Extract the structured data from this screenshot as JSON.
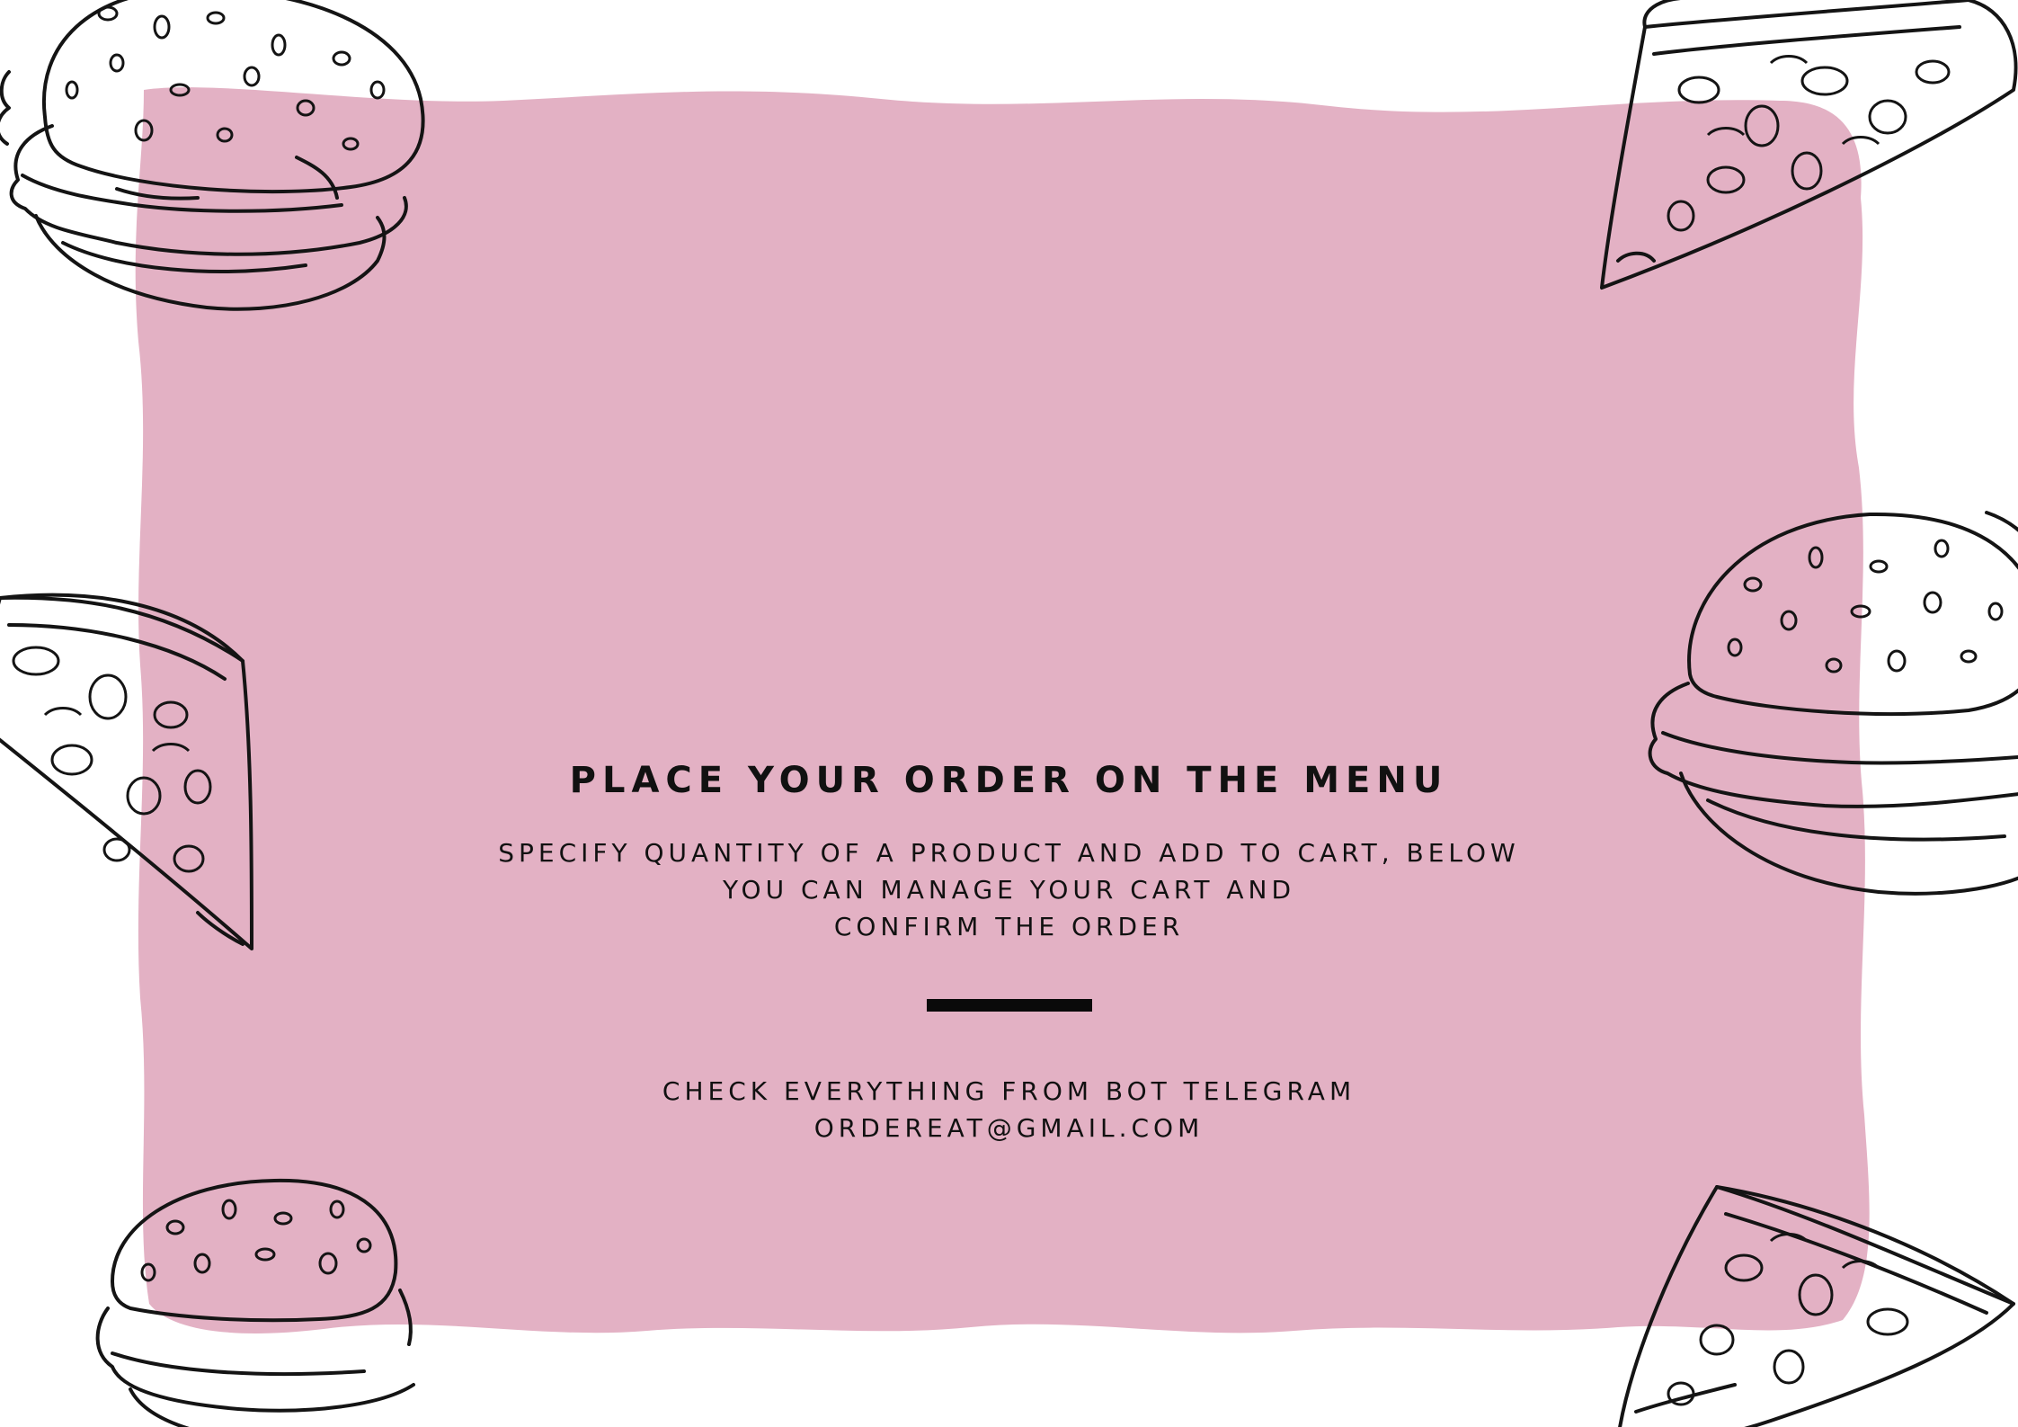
{
  "colors": {
    "background": "#ffffff",
    "panel": "#e3b1c4",
    "text": "#111111",
    "ink": "#141414"
  },
  "illustrations": [
    {
      "name": "burger-illustration",
      "icon": "hamburger-sketch"
    },
    {
      "name": "pizza-slice-illustration",
      "icon": "pizza-slice-sketch"
    }
  ],
  "content": {
    "headline": "PLACE YOUR ORDER ON THE MENU",
    "instructions": [
      "SPECIFY QUANTITY OF A PRODUCT AND ADD TO CART, BELOW",
      "YOU CAN MANAGE YOUR CART AND",
      "CONFIRM THE ORDER"
    ],
    "contact": [
      "CHECK EVERYTHING FROM BOT TELEGRAM",
      "ORDEREAT@GMAIL.COM"
    ]
  }
}
